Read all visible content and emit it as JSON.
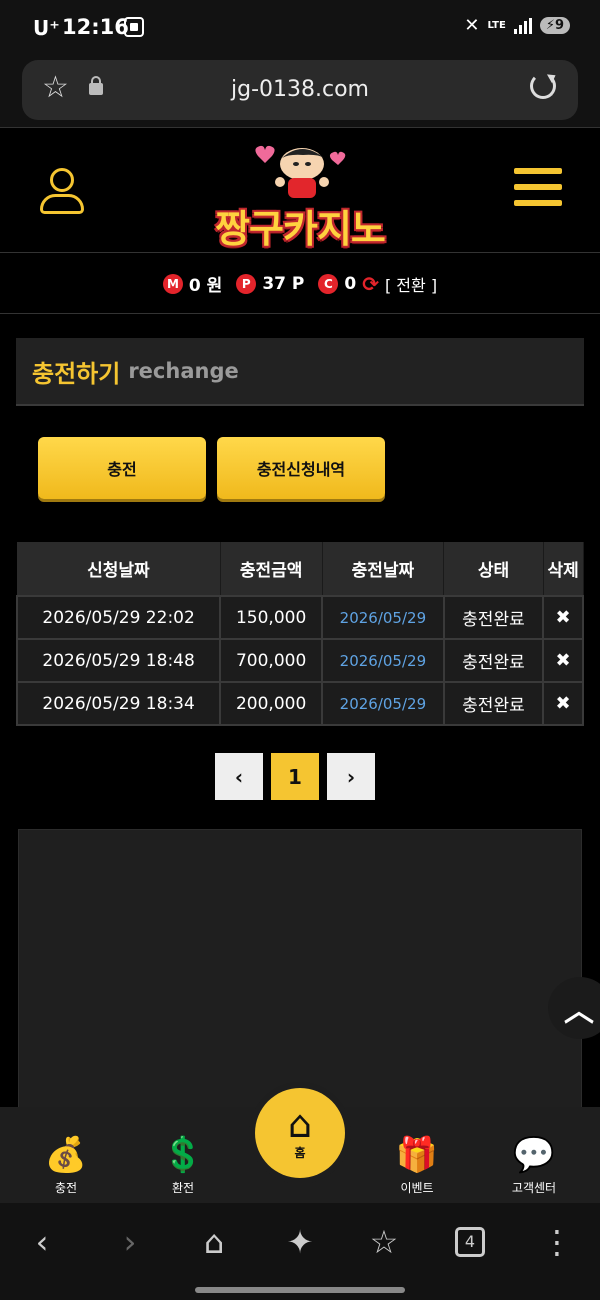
{
  "status_bar": {
    "carrier": "U⁺",
    "time": "12:16",
    "network": "LTE",
    "battery": "9"
  },
  "browser": {
    "url": "jg-0138.com"
  },
  "header": {
    "logo_text": "짱구카지노"
  },
  "points": {
    "money_badge": "M",
    "money_value": "0 원",
    "point_badge": "P",
    "point_value": "37 P",
    "coin_badge": "C",
    "coin_value": "0",
    "convert_label": "[ 전환 ]"
  },
  "section": {
    "title_ko": "충전하기",
    "title_en": "rechange"
  },
  "buttons": {
    "charge": "충전",
    "history": "충전신청내역"
  },
  "table": {
    "headers": [
      "신청날짜",
      "충전금액",
      "충전날짜",
      "상태",
      "삭제"
    ],
    "rows": [
      {
        "request_date": "2026/05/29 22:02",
        "amount": "150,000",
        "charge_date": "2026/05/29",
        "status": "충전완료",
        "delete": "✖"
      },
      {
        "request_date": "2026/05/29 18:48",
        "amount": "700,000",
        "charge_date": "2026/05/29",
        "status": "충전완료",
        "delete": "✖"
      },
      {
        "request_date": "2026/05/29 18:34",
        "amount": "200,000",
        "charge_date": "2026/05/29",
        "status": "충전완료",
        "delete": "✖"
      }
    ]
  },
  "pagination": {
    "prev": "‹",
    "current": "1",
    "next": "›"
  },
  "bottom_nav": {
    "charge": "충전",
    "exchange": "환전",
    "home": "홈",
    "event": "이벤트",
    "support": "고객센터"
  },
  "android_nav": {
    "tabs_count": "4"
  },
  "colors": {
    "accent": "#f5c531",
    "badge": "#e3242b",
    "link": "#5fa3e3"
  }
}
